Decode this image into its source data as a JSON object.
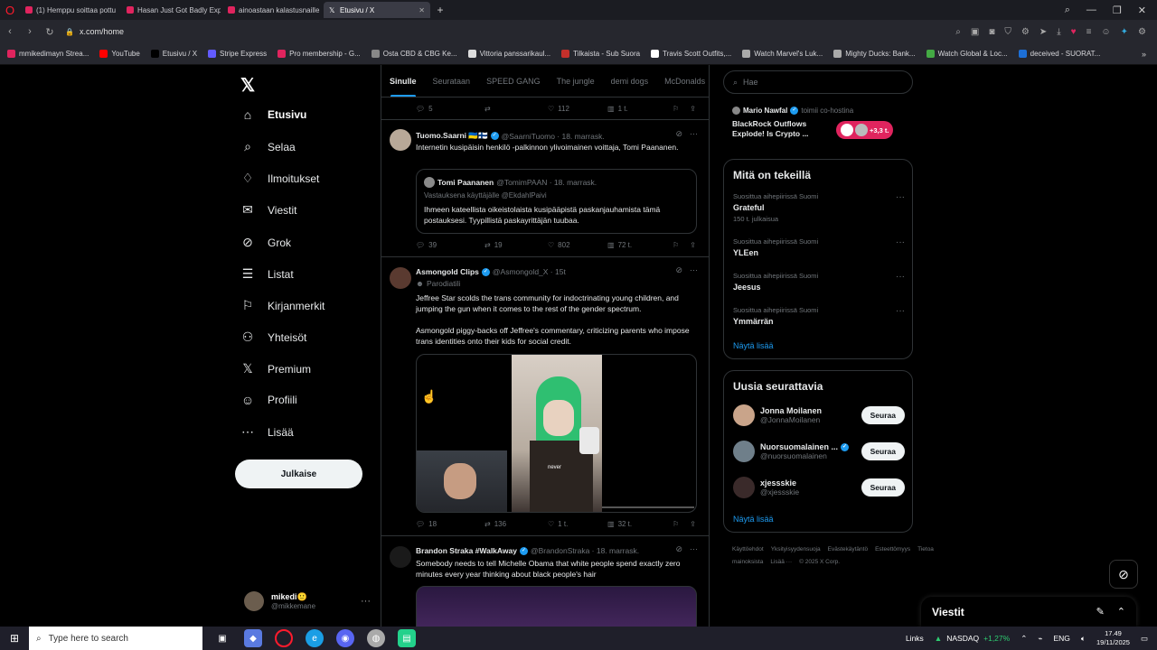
{
  "browser": {
    "tabs": [
      {
        "label": "(1) Hemppu soittaa pottu"
      },
      {
        "label": "Hasan Just Got Badly Expo"
      },
      {
        "label": "ainoastaan kalastusnaille"
      },
      {
        "label": "Etusivu / X"
      }
    ],
    "url": "x.com/home",
    "bookmarks": [
      {
        "label": "mmikedimayn Strea...",
        "color": "#e0245e"
      },
      {
        "label": "YouTube",
        "color": "#ff0000"
      },
      {
        "label": "Etusivu / X",
        "color": "#000000"
      },
      {
        "label": "Stripe Express",
        "color": "#635bff"
      },
      {
        "label": "Pro membership - G...",
        "color": "#e0245e"
      },
      {
        "label": "Osta CBD & CBG Ke...",
        "color": "#888888"
      },
      {
        "label": "Vittoria panssarikaul...",
        "color": "#dddddd"
      },
      {
        "label": "Tilkaista - Sub Suora",
        "color": "#c4302b"
      },
      {
        "label": "Travis Scott Outfits,...",
        "color": "#ffffff"
      },
      {
        "label": "Watch Marvel's Luk...",
        "color": "#aaaaaa"
      },
      {
        "label": "Mighty Ducks: Bank...",
        "color": "#aaaaaa"
      },
      {
        "label": "Watch Global & Loc...",
        "color": "#44aa44"
      },
      {
        "label": "deceived - SUORAT...",
        "color": "#1d6fd6"
      }
    ]
  },
  "nav": {
    "items": [
      {
        "label": "Etusivu",
        "icon": "home-icon",
        "glyph": "⌂"
      },
      {
        "label": "Selaa",
        "icon": "search-icon",
        "glyph": "⌕"
      },
      {
        "label": "Ilmoitukset",
        "icon": "bell-icon",
        "glyph": "♢"
      },
      {
        "label": "Viestit",
        "icon": "mail-icon",
        "glyph": "✉"
      },
      {
        "label": "Grok",
        "icon": "grok-icon",
        "glyph": "⊘"
      },
      {
        "label": "Listat",
        "icon": "list-icon",
        "glyph": "☰"
      },
      {
        "label": "Kirjanmerkit",
        "icon": "bookmark-icon",
        "glyph": "⚐"
      },
      {
        "label": "Yhteisöt",
        "icon": "communities-icon",
        "glyph": "⚇"
      },
      {
        "label": "Premium",
        "icon": "x-premium-icon",
        "glyph": "𝕏"
      },
      {
        "label": "Profiili",
        "icon": "profile-icon",
        "glyph": "☺"
      },
      {
        "label": "Lisää",
        "icon": "more-icon",
        "glyph": "⋯"
      }
    ],
    "post_label": "Julkaise",
    "account": {
      "name": "mikedi🙂",
      "handle": "@mikkemane"
    }
  },
  "timeline": {
    "tabs": [
      "Sinulle",
      "Seurataan",
      "SPEED GANG",
      "The jungle",
      "demi dogs",
      "McDonalds"
    ],
    "top_actions": {
      "replies": "5",
      "reposts": "",
      "likes": "112",
      "views": "1 t."
    },
    "tweets": [
      {
        "name": "Tuomo.Saarni 🇺🇦🇫🇮",
        "handle": "@SaarniTuomo · 18. marrask.",
        "text": "Internetin kusipäisin henkilö -palkinnon ylivoimainen voittaja, Tomi Paananen.",
        "quote": {
          "name": "Tomi Paananen",
          "handle": "@TomimPAAN · 18. marrask.",
          "sub": "Vastauksena käyttäjälle @EkdahlPaivi",
          "text": "Ihmeen kateellista oikeistolaista kusipääpistä paskanjauhamista tämä postauksesi. Tyypillistä paskayrittäjän tuubaa."
        },
        "actions": {
          "replies": "39",
          "reposts": "19",
          "likes": "802",
          "views": "72 t."
        }
      },
      {
        "name": "Asmongold Clips",
        "handle": "@Asmongold_X · 15t",
        "badge": "Parodiatili",
        "text1": "Jeffree Star scolds the trans community for indoctrinating young children, and jumping the gun when it comes to the rest of the gender spectrum.",
        "text2": "Asmongold piggy-backs off Jeffree's commentary, criticizing parents who impose trans identities onto their kids for social credit.",
        "video_caption": "never",
        "actions": {
          "replies": "18",
          "reposts": "136",
          "likes": "1 t.",
          "views": "32 t."
        }
      },
      {
        "name": "Brandon Straka #WalkAway",
        "handle": "@BrandonStraka · 18. marrask.",
        "text": "Somebody needs to tell Michelle Obama that white people spend exactly zero minutes every year thinking about black people's hair"
      }
    ]
  },
  "right": {
    "search_placeholder": "Hae",
    "news": {
      "author": "Mario Nawfal",
      "meta": "toimii co-hostina",
      "title": "BlackRock Outflows Explode! Is Crypto ...",
      "count": "+3,3 t."
    },
    "trends_title": "Mitä on tekeillä",
    "trends": [
      {
        "context": "Suosittua aihepiirissä Suomi",
        "title": "Grateful",
        "posts": "150 t. julkaisua"
      },
      {
        "context": "Suosittua aihepiirissä Suomi",
        "title": "YLEen",
        "posts": ""
      },
      {
        "context": "Suosittua aihepiirissä Suomi",
        "title": "Jeesus",
        "posts": ""
      },
      {
        "context": "Suosittua aihepiirissä Suomi",
        "title": "Ymmärrän",
        "posts": ""
      }
    ],
    "show_more": "Näytä lisää",
    "follow_title": "Uusia seurattavia",
    "follows": [
      {
        "name": "Jonna Moilanen",
        "handle": "@JonnaMoilanen",
        "btn": "Seuraa",
        "verified": false
      },
      {
        "name": "Nuorsuomalainen ...",
        "handle": "@nuorsuomalainen",
        "btn": "Seuraa",
        "verified": true
      },
      {
        "name": "xjessskie",
        "handle": "@xjessskie",
        "btn": "Seuraa",
        "verified": false
      }
    ],
    "footer": [
      "Käyttöehdot",
      "Yksityisyydensuoja",
      "Evästekäytäntö",
      "Esteettömyys",
      "Tietoa mainoksista",
      "Lisää ···",
      "© 2025 X Corp."
    ]
  },
  "messages_dock": {
    "title": "Viestit"
  },
  "taskbar": {
    "search_placeholder": "Type here to search",
    "links": "Links",
    "stock": {
      "name": "NASDAQ",
      "change": "+1,27%"
    },
    "lang": "ENG",
    "time": "17.49",
    "date": "19/11/2025"
  }
}
